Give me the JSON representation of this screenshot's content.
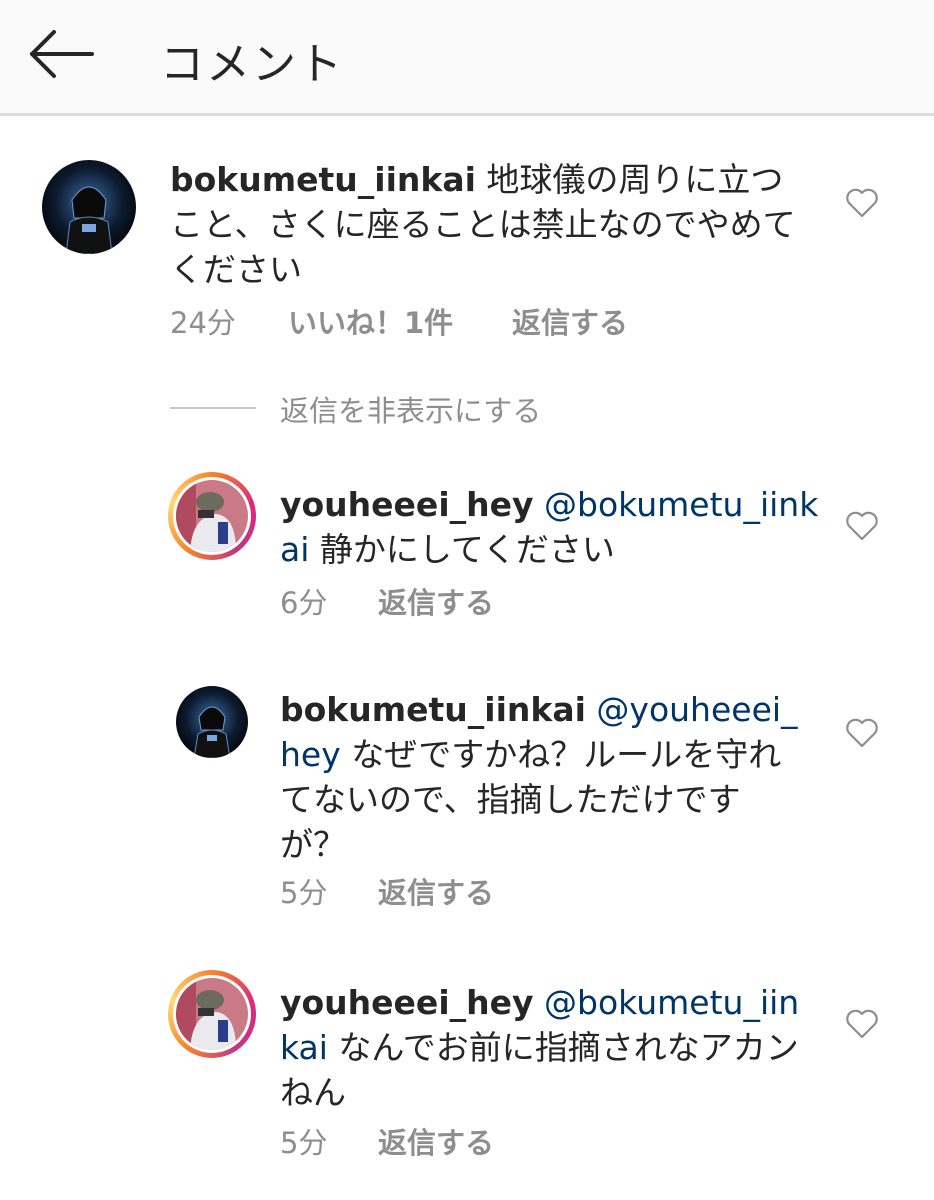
{
  "header": {
    "title": "コメント"
  },
  "main_comment": {
    "username": "bokumetu_iinkai",
    "text": "地球儀の周りに立つこと、さくに座ることは禁止なのでやめてください",
    "time": "24分",
    "likes": "いいね！1件",
    "reply_label": "返信する"
  },
  "hide_replies_label": "返信を非表示にする",
  "replies": [
    {
      "username": "youheeei_hey",
      "mention": "@bokumetu_iinkai",
      "text": "静かにしてください",
      "time": "6分",
      "reply_label": "返信する"
    },
    {
      "username": "bokumetu_iinkai",
      "mention": "@youheeei_hey",
      "text": "なぜですかね？ルールを守れてないので、指摘しただけですが？",
      "time": "5分",
      "reply_label": "返信する"
    },
    {
      "username": "youheeei_hey",
      "mention": "@bokumetu_iinkai",
      "text": "なんでお前に指摘されなアカンねん",
      "time": "5分",
      "reply_label": "返信する"
    }
  ]
}
